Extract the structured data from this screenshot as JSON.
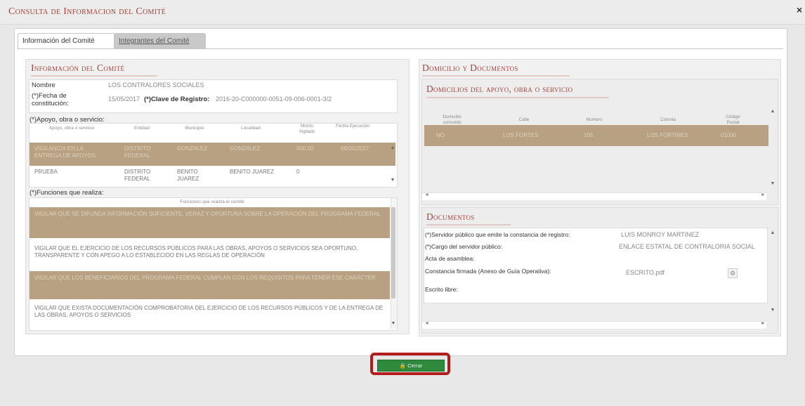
{
  "window": {
    "title": "Consulta de Informacion del Comité",
    "close_label": "×"
  },
  "tabs": [
    {
      "label": "Información del Comité",
      "active": true
    },
    {
      "label": "Integrantes del Comité",
      "active": false
    }
  ],
  "info": {
    "section_title": "Información del Comité",
    "nombre_label": "Nombre",
    "nombre_value": "LOS CONTRALORES SOCIALES",
    "fecha_label_1": "(*)Fecha de",
    "fecha_label_2": "constitución:",
    "fecha_value": "15/05/2017",
    "clave_label": "(*)Clave de Registro:",
    "clave_value": "2016-20-C000000-0051-09-006-0001-3/2",
    "apoyo_label": "(*)Apoyo, obra o servicio:",
    "apoyo_columns": [
      "Apoyo, obra o servicio",
      "Entidad",
      "Municipio",
      "Localidad",
      "Monto Vigilado",
      "Fecha Ejecución"
    ],
    "apoyo_rows": [
      [
        "VIGILANCIA EN LA ENTREGA DE APOYOS",
        "DISTRITO FEDERAL",
        "GONZALEZ",
        "GONZALEZ",
        "500.00",
        "06/05/2017"
      ],
      [
        "PRUEBA",
        "DISTRITO FEDERAL",
        "BENITO JUAREZ",
        "BENITO JUAREZ",
        "0",
        ""
      ]
    ],
    "funciones_label": "(*)Funciones que realiza:",
    "funciones_header": "Funciones que realiza el comité",
    "funciones": [
      "VIGILAR QUE SE DIFUNDA INFORMACIÓN SUFICIENTE, VERAZ Y OPORTUNA SOBRE LA OPERACIÓN DEL PROGRAMA FEDERAL",
      "VIGILAR QUE EL EJERCICIO DE LOS RECURSOS PÚBLICOS PARA LAS OBRAS, APOYOS O SERVICIOS SEA OPORTUNO, TRANSPARENTE Y CON APEGO A LO ESTABLECIDO EN LAS REGLAS DE OPERACIÓN",
      "VIGILAR QUE LOS BENEFICIARIOS DEL PROGRAMA FEDERAL CUMPLAN CON LOS REQUISITOS PARA TENER ESE CARÁCTER",
      "VIGILAR QUE EXISTA DOCUMENTACIÓN COMPROBATORIA DEL EJERCICIO DE LOS RECURSOS PÚBLICOS Y DE LA ENTREGA DE LAS OBRAS, APOYOS O SERVICIOS"
    ]
  },
  "domicilio": {
    "section_title": "Domicilio y Documentos",
    "sub_title": "Domicilios del apoyo, obra o servicio",
    "columns": [
      "Domicilio conocido",
      "Calle",
      "Número",
      "Colonia",
      "Código Postal"
    ],
    "rows": [
      [
        "NO",
        "LOS FORTES",
        "105",
        "LOS FORTINES",
        "01000"
      ]
    ]
  },
  "documentos": {
    "section_title": "Documentos",
    "rows": [
      {
        "label": "(*)Servidor público que emite la constancia de registro:",
        "value": "LUIS MONROY MARTINEZ"
      },
      {
        "label": "(*)Cargo del servidor público:",
        "value": "ENLACE ESTATAL DE CONTRALORIA SOCIAL"
      },
      {
        "label": "Acta de asamblea:",
        "value": ""
      },
      {
        "label": "Constancia firmada (Anexo de Guía Operativa):",
        "value": "ESCRITO.pdf"
      },
      {
        "label": "Escrito libre:",
        "value": ""
      }
    ]
  },
  "footer": {
    "close_button": "Cerrar"
  }
}
